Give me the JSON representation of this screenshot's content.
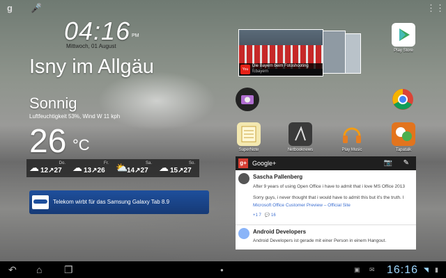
{
  "clock": {
    "time": "04:16",
    "ampm": "PM",
    "date": "Mittwoch, 01 August"
  },
  "weather": {
    "city": "Isny im Allgäu",
    "condition": "Sonnig",
    "details": "Luftfeuchtigkeit 53%, Wind W 11 kph",
    "temp": "26",
    "unit": "°C",
    "forecast": [
      {
        "day": "Do.",
        "range": "12↗27"
      },
      {
        "day": "Fr.",
        "range": "13↗26"
      },
      {
        "day": "Sa.",
        "range": "14↗27"
      },
      {
        "day": "So.",
        "range": "15↗27"
      }
    ]
  },
  "news": {
    "text": "Telekom wirbt für das Samsung Galaxy Tab 8.9",
    "badge": "SAMSUNG"
  },
  "youtube": {
    "title": "Die Bayern beim Fotoshooting",
    "channel": "fcbayern",
    "logo": "You Tube"
  },
  "apps": [
    {
      "label": "Play Store",
      "icon": "play-store-icon"
    },
    {
      "label": "",
      "icon": "camera-icon"
    },
    {
      "label": "",
      "icon": "chrome-icon"
    },
    {
      "label": "SuperNote",
      "icon": "supernote-icon"
    },
    {
      "label": "Netbooknews",
      "icon": "netbooknews-icon"
    },
    {
      "label": "Play Music",
      "icon": "headphones-icon"
    },
    {
      "label": "Tapatalk",
      "icon": "tapatalk-icon"
    }
  ],
  "gplus": {
    "title": "Google+",
    "logo": "g+",
    "posts": [
      {
        "author": "Sascha Pallenberg",
        "text1": "After 9 years of using Open Office i have to admit that i love MS Office 2013",
        "text2": "Sorry guys, i never thought that i would have to admit this but it's the truth. I",
        "link": "Microsoft Office Customer Preview – Official Site",
        "plus": "7",
        "comments": "16"
      },
      {
        "author": "Android Developers",
        "text1": "Android Developers ist gerade mit einer Person in einem Hangout."
      }
    ]
  },
  "status": {
    "time": "16:16"
  },
  "colors": {
    "accent": "#9fd8ff",
    "gplus_red": "#d73d32",
    "news_blue": "#1e4f9c"
  }
}
